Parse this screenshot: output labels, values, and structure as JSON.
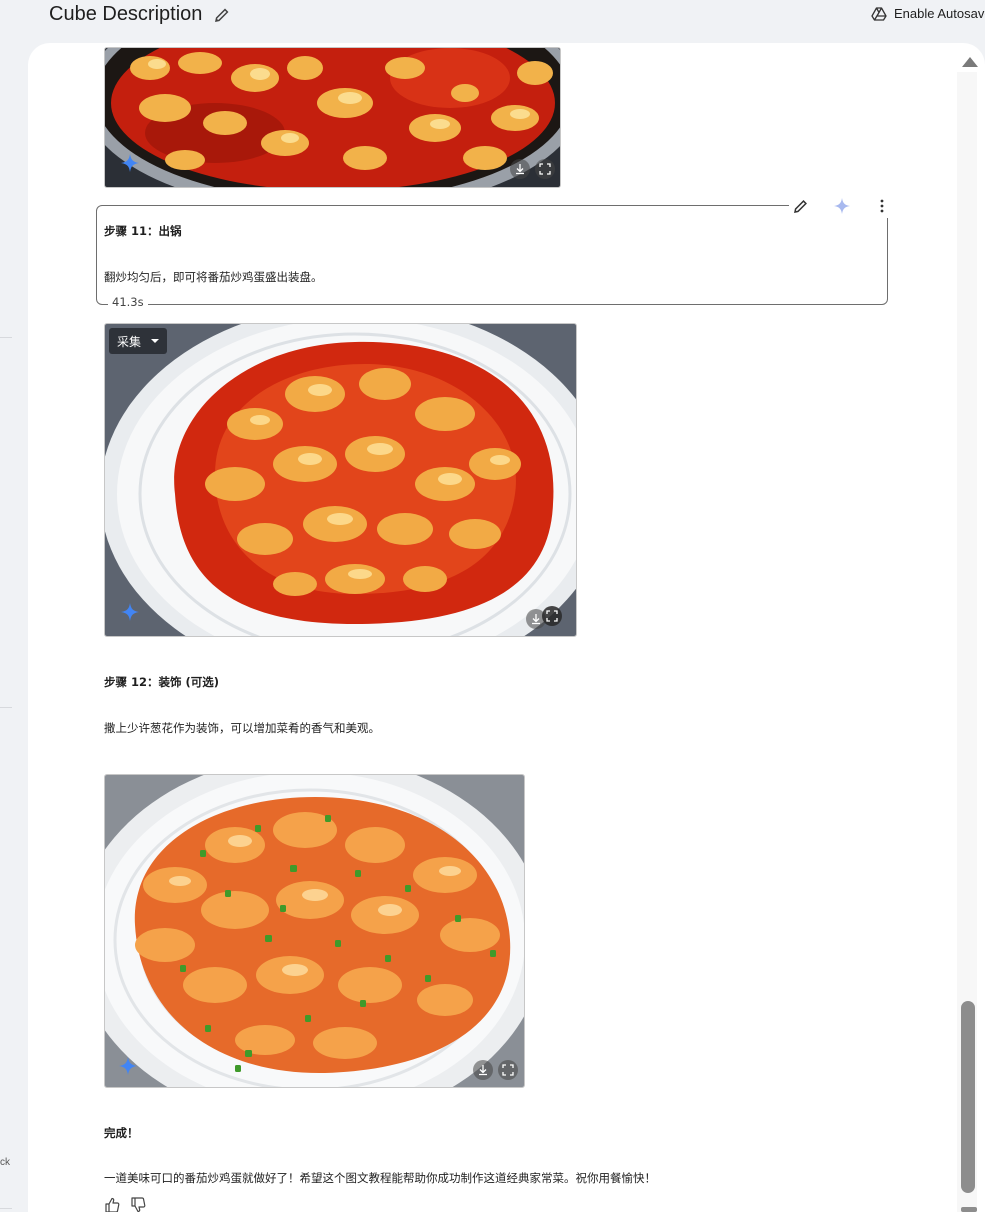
{
  "header": {
    "title": "Cube Description",
    "autosave_label": "Enable Autosave"
  },
  "side": {
    "cut_text": "ck"
  },
  "steps": {
    "step11_title": "步骤 11：出锅",
    "step11_body": "翻炒均匀后，即可将番茄炒鸡蛋盛出装盘。",
    "timer": "41.3s",
    "collect_label": "采集",
    "step12_title": "步骤 12：装饰 (可选)",
    "step12_body": "撒上少许葱花作为装饰，可以增加菜肴的香气和美观。",
    "done_title": "完成！",
    "done_body": "一道美味可口的番茄炒鸡蛋就做好了！希望这个图文教程能帮助你成功制作这道经典家常菜。祝你用餐愉快！"
  },
  "icons": [
    "pencil-icon",
    "drive-icon",
    "sparkle-icon",
    "more-vert-icon",
    "download-icon",
    "fullscreen-icon",
    "thumbs-up-icon",
    "thumbs-down-icon",
    "caret-down-icon"
  ],
  "colors": {
    "page_bg": "#f0f2f5",
    "panel_bg": "#ffffff",
    "sparkle_blue": "#4285f4",
    "sauce_red": "#d42a12",
    "egg_yellow": "#f2b24a"
  }
}
